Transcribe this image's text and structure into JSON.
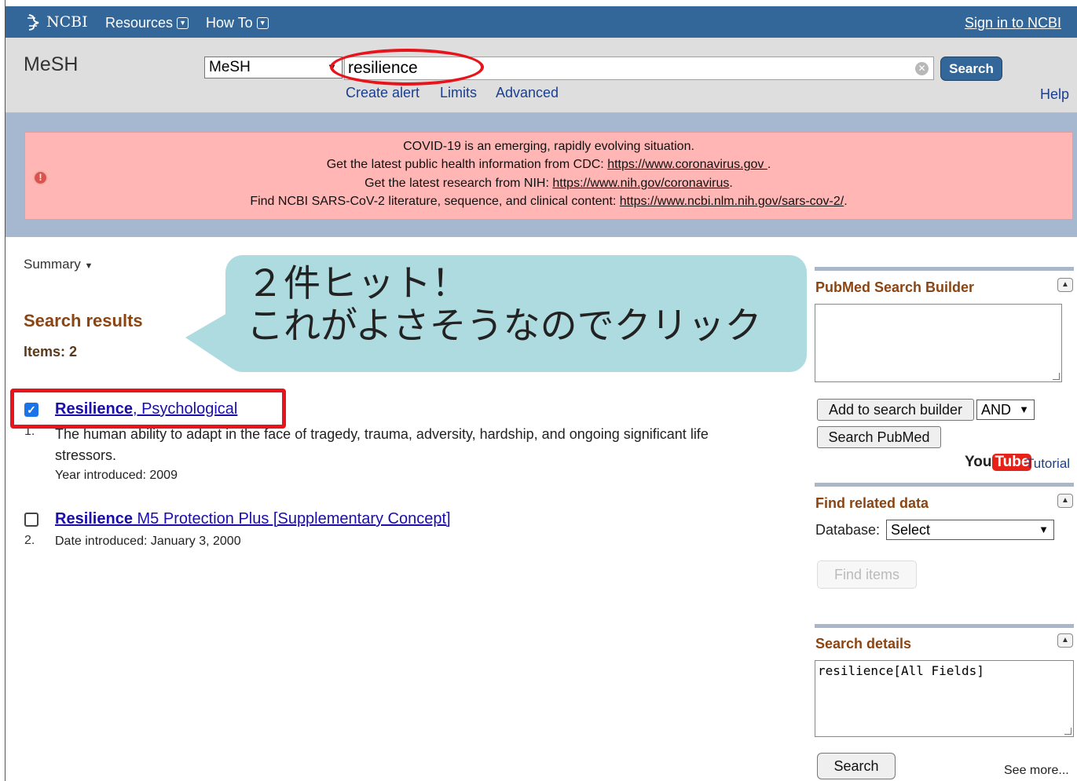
{
  "topbar": {
    "logo": "NCBI",
    "nav": [
      "Resources",
      "How To"
    ],
    "signin": "Sign in to NCBI"
  },
  "search": {
    "db_title": "MeSH",
    "db_selected": "MeSH",
    "query": "resilience",
    "button": "Search",
    "links": [
      "Create alert",
      "Limits",
      "Advanced"
    ],
    "help": "Help"
  },
  "alert": {
    "line1": "COVID-19 is an emerging, rapidly evolving situation.",
    "line2_prefix": "Get the latest public health information from CDC: ",
    "line2_link": "https://www.coronavirus.gov ",
    "line2_suffix": ".",
    "line3_prefix": "Get the latest research from NIH: ",
    "line3_link": "https://www.nih.gov/coronavirus",
    "line3_suffix": ".",
    "line4_prefix": "Find NCBI SARS-CoV-2 literature, sequence, and clinical content: ",
    "line4_link": "https://www.ncbi.nlm.nih.gov/sars-cov-2/",
    "line4_suffix": "."
  },
  "results": {
    "view": "Summary",
    "heading": "Search results",
    "items": "Items: 2",
    "list": [
      {
        "num": "1.",
        "title_bold": "Resilience",
        "title_rest": ", Psychological",
        "checked": true,
        "desc_line1": "The human ability to adapt in the face of tragedy, trauma, adversity, hardship, and ongoing significant life",
        "desc_line2": "stressors.",
        "meta": "Year introduced: 2009"
      },
      {
        "num": "2.",
        "title_bold": "Resilience",
        "title_rest": " M5 Protection Plus [Supplementary Concept]",
        "checked": false,
        "meta": "Date introduced: January 3, 2000"
      }
    ]
  },
  "annotation": {
    "line1": "２件ヒット！",
    "line2": "これがよさそうなのでクリック"
  },
  "sidebar": {
    "builder": {
      "title": "PubMed Search Builder",
      "add_button": "Add to search builder",
      "operator": "AND",
      "search_button": "Search PubMed",
      "youtube_you": "You",
      "youtube_tube": "Tube",
      "tutorial": "Tutorial"
    },
    "related": {
      "title": "Find related data",
      "db_label": "Database:",
      "db_selected": "Select",
      "find_button": "Find items"
    },
    "details": {
      "title": "Search details",
      "query": "resilience[All Fields]",
      "search_button": "Search",
      "see_more": "See more..."
    }
  },
  "colors": {
    "topbar": "#336699",
    "alert_bg": "#ffb6b5",
    "heading_brown": "#8b4513",
    "annotation_red": "#e8141b",
    "bubble": "#aedbdf"
  }
}
